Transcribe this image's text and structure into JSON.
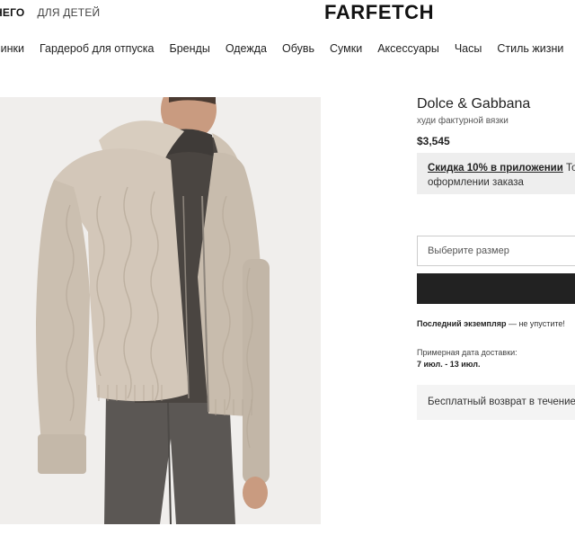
{
  "header": {
    "gender_tabs": [
      {
        "label": "НЕГО",
        "active": true
      },
      {
        "label": "ДЛЯ ДЕТЕЙ",
        "active": false
      }
    ],
    "logo": "FARFETCH"
  },
  "nav": {
    "items": [
      "винки",
      "Гардероб для отпуска",
      "Бренды",
      "Одежда",
      "Обувь",
      "Сумки",
      "Аксессуары",
      "Часы",
      "Стиль жизни"
    ]
  },
  "product": {
    "brand": "Dolce & Gabbana",
    "description": "худи фактурной вязки",
    "price": "$3,545",
    "promo": {
      "link": "Скидка 10% в приложении",
      "text": " Тол",
      "line2": "оформлении заказа"
    },
    "size_placeholder": "Выберите размер",
    "last_item_bold": "Последний экземпляр",
    "last_item_text": " — не упустите!",
    "delivery_label": "Примерная дата доставки:",
    "delivery_dates": "7 июл. - 13 июл.",
    "returns": "Бесплатный возврат в течение"
  },
  "colors": {
    "button_bg": "#222222",
    "promo_bg": "#eeeeee",
    "image_bg": "#f0eeec",
    "sweater": "#cfc3b4",
    "turtleneck": "#4a4541",
    "trousers": "#5b5754"
  }
}
